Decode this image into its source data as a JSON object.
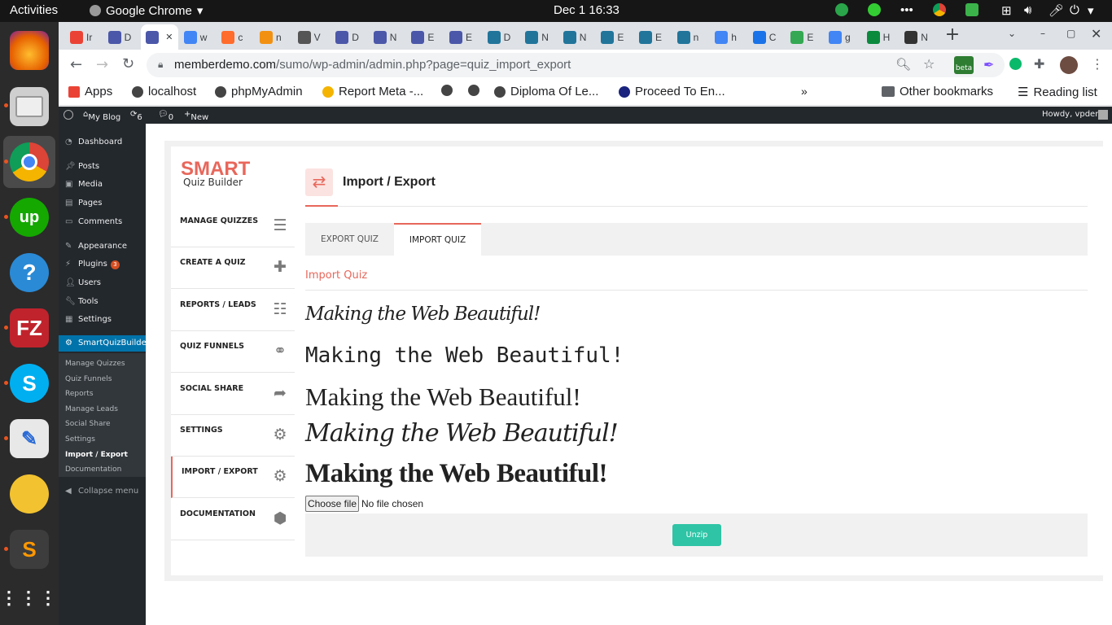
{
  "gnome": {
    "activities": "Activities",
    "app": "Google Chrome",
    "clock": "Dec 1  16:33"
  },
  "chrome": {
    "tabs": [
      {
        "label": "Ir",
        "icon": "gmail-icon"
      },
      {
        "label": "D",
        "icon": "smart-quiz-icon"
      },
      {
        "label": "",
        "icon": "smart-quiz-icon",
        "active": true
      },
      {
        "label": "w",
        "icon": "google-icon"
      },
      {
        "label": "c",
        "icon": "cpanel-icon"
      },
      {
        "label": "n",
        "icon": "phpmyadmin-icon"
      },
      {
        "label": "V",
        "icon": "generic-icon"
      },
      {
        "label": "D",
        "icon": "smart-quiz-icon"
      },
      {
        "label": "N",
        "icon": "smart-quiz-icon"
      },
      {
        "label": "E",
        "icon": "smart-quiz-icon"
      },
      {
        "label": "E",
        "icon": "smart-quiz-icon"
      },
      {
        "label": "D",
        "icon": "wordpress-icon"
      },
      {
        "label": "N",
        "icon": "wordpress-icon"
      },
      {
        "label": "N",
        "icon": "wordpress-icon"
      },
      {
        "label": "E",
        "icon": "wordpress-icon"
      },
      {
        "label": "E",
        "icon": "wordpress-icon"
      },
      {
        "label": "n",
        "icon": "wordpress-icon"
      },
      {
        "label": "h",
        "icon": "google-icon"
      },
      {
        "label": "C",
        "icon": "code-icon"
      },
      {
        "label": "E",
        "icon": "multicolor-icon"
      },
      {
        "label": "g",
        "icon": "google-icon"
      },
      {
        "label": "H",
        "icon": "w-icon"
      },
      {
        "label": "N",
        "icon": "github-icon"
      }
    ],
    "url_host": "memberdemo.com",
    "url_path": "/sumo/wp-admin/admin.php?page=quiz_import_export",
    "beta": "beta",
    "bookmarks": [
      {
        "label": "Apps",
        "icon": "apps-grid-icon"
      },
      {
        "label": "localhost",
        "icon": "globe-icon"
      },
      {
        "label": "phpMyAdmin",
        "icon": "globe-icon"
      },
      {
        "label": "Report Meta -...",
        "icon": "drive-icon"
      },
      {
        "label": "",
        "icon": "globe-icon"
      },
      {
        "label": "",
        "icon": "globe-icon"
      },
      {
        "label": "Diploma Of Le...",
        "icon": "globe-icon"
      },
      {
        "label": "Proceed To En...",
        "icon": "graduation-icon"
      }
    ],
    "more": "»",
    "other_bookmarks": "Other bookmarks",
    "reading_list": "Reading list"
  },
  "wp": {
    "admin_bar": {
      "site": "My Blog",
      "updates": "6",
      "comments": "0",
      "new": "New",
      "howdy": "Howdy, vpdemo"
    },
    "menu": [
      {
        "label": "Dashboard",
        "icon": "dashboard-icon"
      },
      {
        "label": "Posts",
        "icon": "pin-icon"
      },
      {
        "label": "Media",
        "icon": "media-icon"
      },
      {
        "label": "Pages",
        "icon": "pages-icon"
      },
      {
        "label": "Comments",
        "icon": "comments-icon"
      },
      {
        "label": "Appearance",
        "icon": "brush-icon"
      },
      {
        "label": "Plugins",
        "icon": "plugin-icon",
        "badge": "3"
      },
      {
        "label": "Users",
        "icon": "users-icon"
      },
      {
        "label": "Tools",
        "icon": "wrench-icon"
      },
      {
        "label": "Settings",
        "icon": "settings-icon"
      },
      {
        "label": "SmartQuizBuilder",
        "icon": "gear-icon",
        "active": true
      }
    ],
    "submenu": [
      "Manage Quizzes",
      "Quiz Funnels",
      "Reports",
      "Manage Leads",
      "Social Share",
      "Settings",
      "Import / Export",
      "Documentation"
    ],
    "collapse": "Collapse menu"
  },
  "sqb": {
    "logo_smart": "SMART",
    "logo_sub": "Quiz Builder",
    "nav": [
      {
        "label": "MANAGE QUIZZES",
        "icon": "menu-lines-icon"
      },
      {
        "label": "CREATE A QUIZ",
        "icon": "plus-icon"
      },
      {
        "label": "REPORTS / LEADS",
        "icon": "list-icon"
      },
      {
        "label": "QUIZ FUNNELS",
        "icon": "link-icon"
      },
      {
        "label": "SOCIAL SHARE",
        "icon": "share-icon"
      },
      {
        "label": "SETTINGS",
        "icon": "gear-icon"
      },
      {
        "label": "IMPORT / EXPORT",
        "icon": "gear-icon",
        "active": true
      },
      {
        "label": "DOCUMENTATION",
        "icon": "box-icon"
      }
    ],
    "page_title": "Import / Export",
    "tabs": [
      {
        "label": "EXPORT QUIZ"
      },
      {
        "label": "IMPORT QUIZ",
        "active": true
      }
    ],
    "section_title": "Import Quiz",
    "font_samples": [
      "Making the Web Beautiful!",
      "Making the Web Beautiful!",
      "Making the Web Beautiful!",
      "Making the Web Beautiful!",
      "Making the Web Beautiful!"
    ],
    "choose_file": "Choose file",
    "no_file": "No file chosen",
    "unzip": "Unzip",
    "accent": "#e8675b",
    "button_color": "#2ec4a5"
  }
}
